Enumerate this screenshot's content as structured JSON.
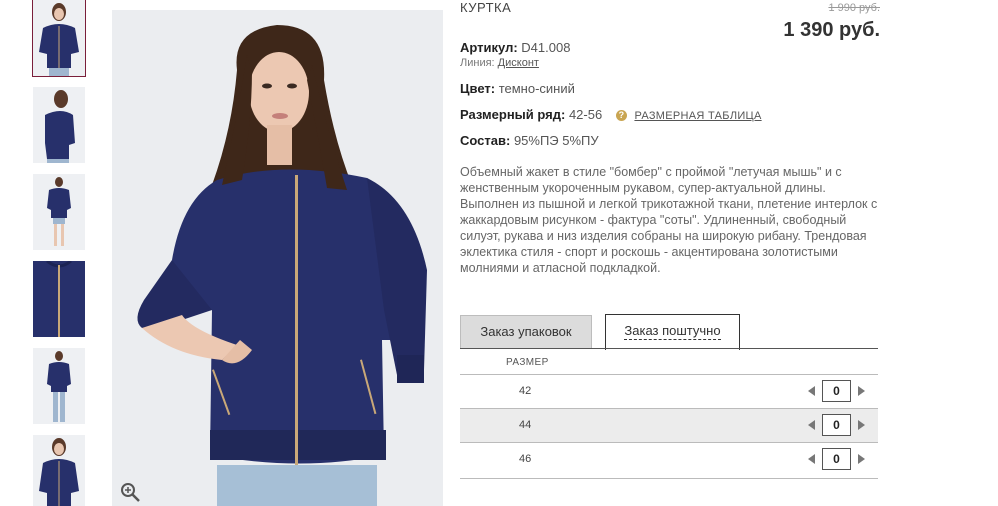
{
  "product": {
    "title": "КУРТКА",
    "old_price": "1 990 руб.",
    "price": "1 390 руб."
  },
  "details": {
    "article_label": "Артикул:",
    "article_value": "D41.008",
    "line_label": "Линия:",
    "line_value": "Дисконт",
    "color_label": "Цвет:",
    "color_value": "темно-синий",
    "size_range_label": "Размерный ряд:",
    "size_range_value": "42-56",
    "size_table_link": "РАЗМЕРНАЯ ТАБЛИЦА",
    "composition_label": "Состав:",
    "composition_value": "95%ПЭ 5%ПУ"
  },
  "description": "Объемный жакет в стиле \"бомбер\" с  проймой \"летучая мышь\" и с женственным укороченным рукавом, супер-актуальной длины. Выполнен из пышной и легкой трикотажной ткани, плетение интерлок с жаккардовым рисунком - фактура \"соты\". Удлиненный, свободный силуэт, рукава и низ изделия собраны на широкую рибану. Трендовая эклектика стиля - спорт и роскошь - акцентирована золотистыми молниями и атласной подкладкой.",
  "order": {
    "tabs": [
      "Заказ упаковок",
      "Заказ поштучно"
    ],
    "active_tab": "Заказ поштучно",
    "column_header": "РАЗМЕР",
    "rows": [
      {
        "size": "42",
        "qty": "0"
      },
      {
        "size": "44",
        "qty": "0"
      },
      {
        "size": "46",
        "qty": "0"
      }
    ]
  },
  "icons": {
    "zoom": "magnifier-plus-icon",
    "help": "question-icon",
    "decrease": "triangle-left-icon",
    "increase": "triangle-right-icon"
  },
  "colors": {
    "jacket": "#27306b",
    "accent_border": "#7a1f3a",
    "help_icon": "#c9a552"
  }
}
